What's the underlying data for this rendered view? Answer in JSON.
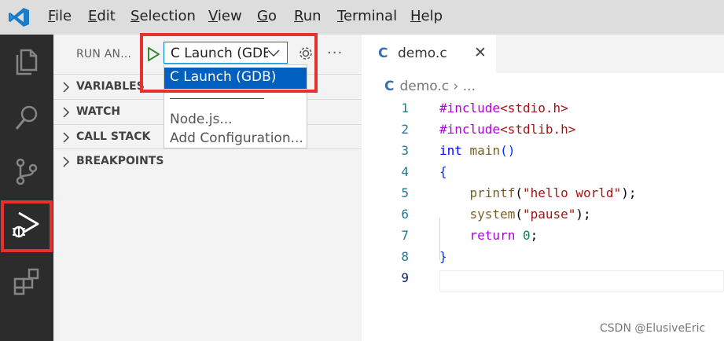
{
  "menu": {
    "items": [
      {
        "u": "F",
        "rest": "ile"
      },
      {
        "u": "E",
        "rest": "dit"
      },
      {
        "u": "S",
        "rest": "election"
      },
      {
        "u": "V",
        "rest": "iew"
      },
      {
        "u": "G",
        "rest": "o"
      },
      {
        "u": "R",
        "rest": "un"
      },
      {
        "u": "T",
        "rest": "erminal"
      },
      {
        "u": "H",
        "rest": "elp"
      }
    ]
  },
  "sidebar": {
    "title": "RUN AN...",
    "config_selected": "C Launch (GDB)",
    "more": "···",
    "sections": [
      "VARIABLES",
      "WATCH",
      "CALL STACK",
      "BREAKPOINTS"
    ]
  },
  "dropdown": {
    "options": [
      "C Launch (GDB)",
      "Node.js...",
      "Add Configuration..."
    ]
  },
  "editor": {
    "tab_label": "demo.c",
    "tab_icon": "C",
    "close": "✕",
    "breadcrumb_file": "demo.c",
    "breadcrumb_rest": " › ...",
    "line_numbers": [
      "1",
      "2",
      "3",
      "4",
      "5",
      "6",
      "7",
      "8",
      "9"
    ],
    "code": {
      "l1a": "#include",
      "l1b": "<stdio.h>",
      "l2a": "#include",
      "l2b": "<stdlib.h>",
      "l3a": "int",
      "l3b": " ",
      "l3c": "main",
      "l3d": "()",
      "l4": "{",
      "l5a": "    ",
      "l5b": "printf",
      "l5c": "(",
      "l5d": "\"hello world\"",
      "l5e": ");",
      "l6a": "    ",
      "l6b": "system",
      "l6c": "(",
      "l6d": "\"pause\"",
      "l6e": ");",
      "l7a": "    ",
      "l7b": "return",
      "l7c": " ",
      "l7d": "0",
      "l7e": ";",
      "l8": "}"
    }
  },
  "watermark": "CSDN @ElusiveEric",
  "colors": {
    "accent": "#007acc",
    "highlight_box": "#e8302e",
    "selected_option": "#0060c0"
  },
  "icons": [
    "vscode-logo-icon",
    "explorer-icon",
    "search-icon",
    "source-control-icon",
    "run-debug-icon",
    "extensions-icon",
    "play-icon",
    "chevron-down-icon",
    "gear-icon",
    "chevron-right-icon",
    "close-icon",
    "c-file-icon"
  ]
}
